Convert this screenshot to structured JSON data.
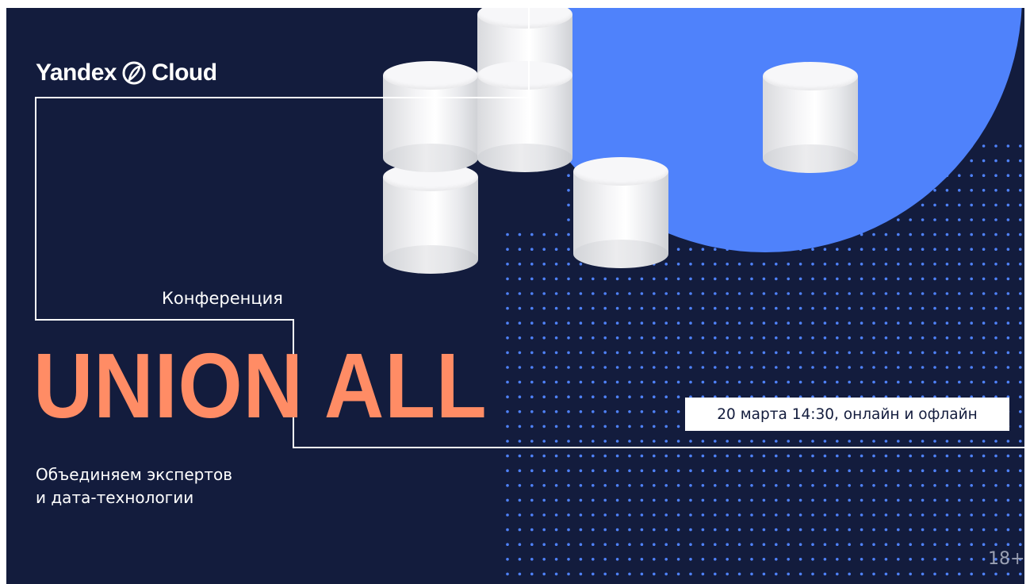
{
  "logo": {
    "brand_left": "Yandex",
    "brand_right": "Cloud"
  },
  "event": {
    "label": "Конференция",
    "title": "UNION ALL",
    "date_place": "20 марта 14:30, онлайн и офлайн",
    "tagline_line1": "Объединяем экспертов",
    "tagline_line2": "и дата-технологии",
    "age_rating": "18+"
  },
  "colors": {
    "background": "#131c3d",
    "circle": "#4f82fb",
    "dots": "#4f82fb",
    "title": "#ff8c65",
    "lines": "#ffffff"
  }
}
